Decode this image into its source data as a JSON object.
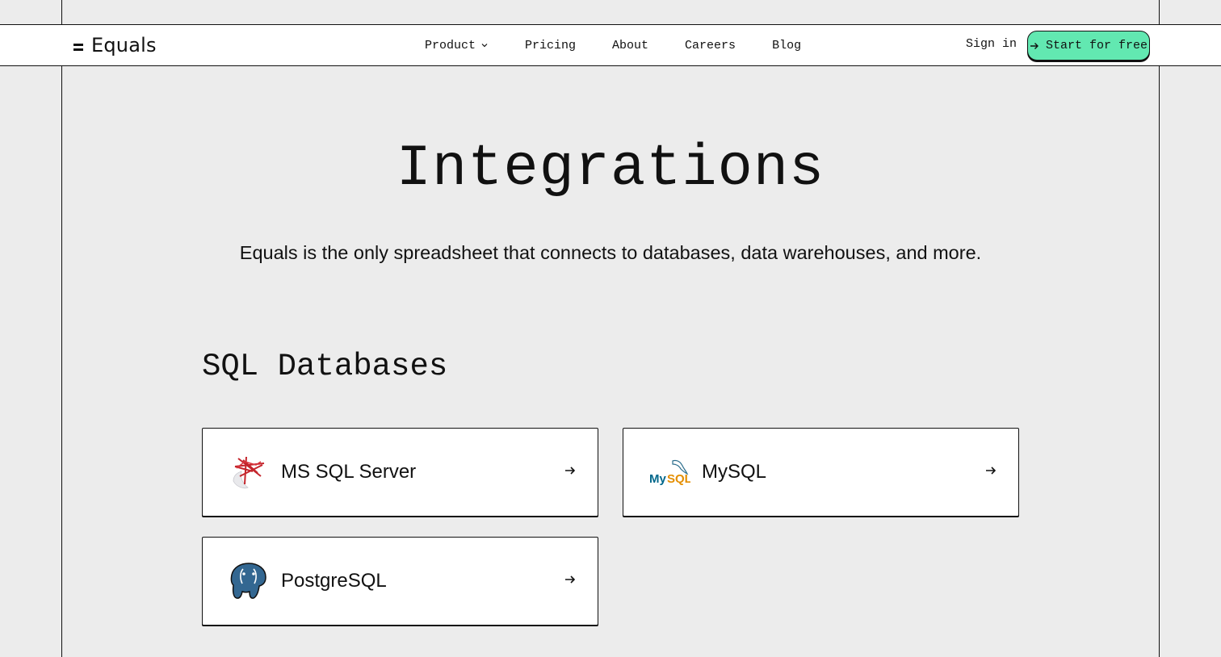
{
  "brand": {
    "name": "Equals"
  },
  "nav": {
    "items": [
      {
        "label": "Product",
        "has_dropdown": true
      },
      {
        "label": "Pricing"
      },
      {
        "label": "About"
      },
      {
        "label": "Careers"
      },
      {
        "label": "Blog"
      }
    ],
    "sign_in": "Sign in",
    "cta": "Start for free",
    "cta_color": "#62e8b1"
  },
  "hero": {
    "title": "Integrations",
    "subtitle": "Equals is the only spreadsheet that connects to databases, data warehouses, and more."
  },
  "section": {
    "title": "SQL Databases",
    "cards": [
      {
        "name": "MS SQL Server",
        "icon": "ms-sql-server-logo"
      },
      {
        "name": "MySQL",
        "icon": "mysql-logo"
      },
      {
        "name": "PostgreSQL",
        "icon": "postgresql-logo"
      }
    ]
  }
}
